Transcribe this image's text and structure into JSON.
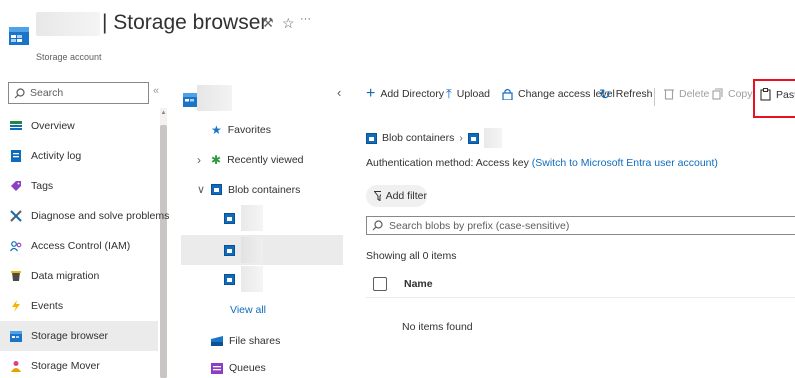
{
  "header": {
    "title": "| Storage browser",
    "subtitle": "Storage account",
    "pin_icon": "pin-icon",
    "star_icon": "star-icon",
    "more_label": "···"
  },
  "left_nav": {
    "search_placeholder": "Search",
    "collapse_label": "«",
    "items": [
      {
        "label": "Overview",
        "icon": "overview-icon",
        "color": "#0f6cbd"
      },
      {
        "label": "Activity log",
        "icon": "activity-log-icon",
        "color": "#0f6cbd"
      },
      {
        "label": "Tags",
        "icon": "tag-icon",
        "color": "#8b3fc4"
      },
      {
        "label": "Diagnose and solve problems",
        "icon": "diagnose-icon",
        "color": "#605e5c"
      },
      {
        "label": "Access Control (IAM)",
        "icon": "iam-icon",
        "color": "#0f6cbd"
      },
      {
        "label": "Data migration",
        "icon": "data-migration-icon",
        "color": "#4a4a4a"
      },
      {
        "label": "Events",
        "icon": "events-icon",
        "color": "#f7b500"
      },
      {
        "label": "Storage browser",
        "icon": "storage-browser-icon",
        "color": "#0f6cbd",
        "selected": true
      },
      {
        "label": "Storage Mover",
        "icon": "storage-mover-icon",
        "color": "#e03e8a"
      }
    ]
  },
  "tree": {
    "collapse_label": "‹",
    "favorites": "Favorites",
    "recently_viewed": "Recently viewed",
    "blob_containers": "Blob containers",
    "view_all": "View all",
    "file_shares": "File shares",
    "queues": "Queues",
    "expand_arrow": "›",
    "collapse_arrow": "⌄"
  },
  "toolbar": {
    "add_directory": "Add Directory",
    "upload": "Upload",
    "change_access": "Change access level",
    "refresh": "Refresh",
    "delete": "Delete",
    "copy": "Copy",
    "paste": "Paste"
  },
  "content": {
    "breadcrumb_root": "Blob containers",
    "breadcrumb_sep": "›",
    "auth_prefix": "Authentication method: Access key",
    "auth_link": "(Switch to Microsoft Entra user account)",
    "add_filter": "Add filter",
    "search_placeholder": "Search blobs by prefix (case-sensitive)",
    "showing": "Showing all 0 items",
    "col_name": "Name",
    "empty": "No items found"
  },
  "colors": {
    "accent": "#0f6cbd",
    "highlight": "#e81123",
    "selected_bg": "#ebebeb"
  }
}
